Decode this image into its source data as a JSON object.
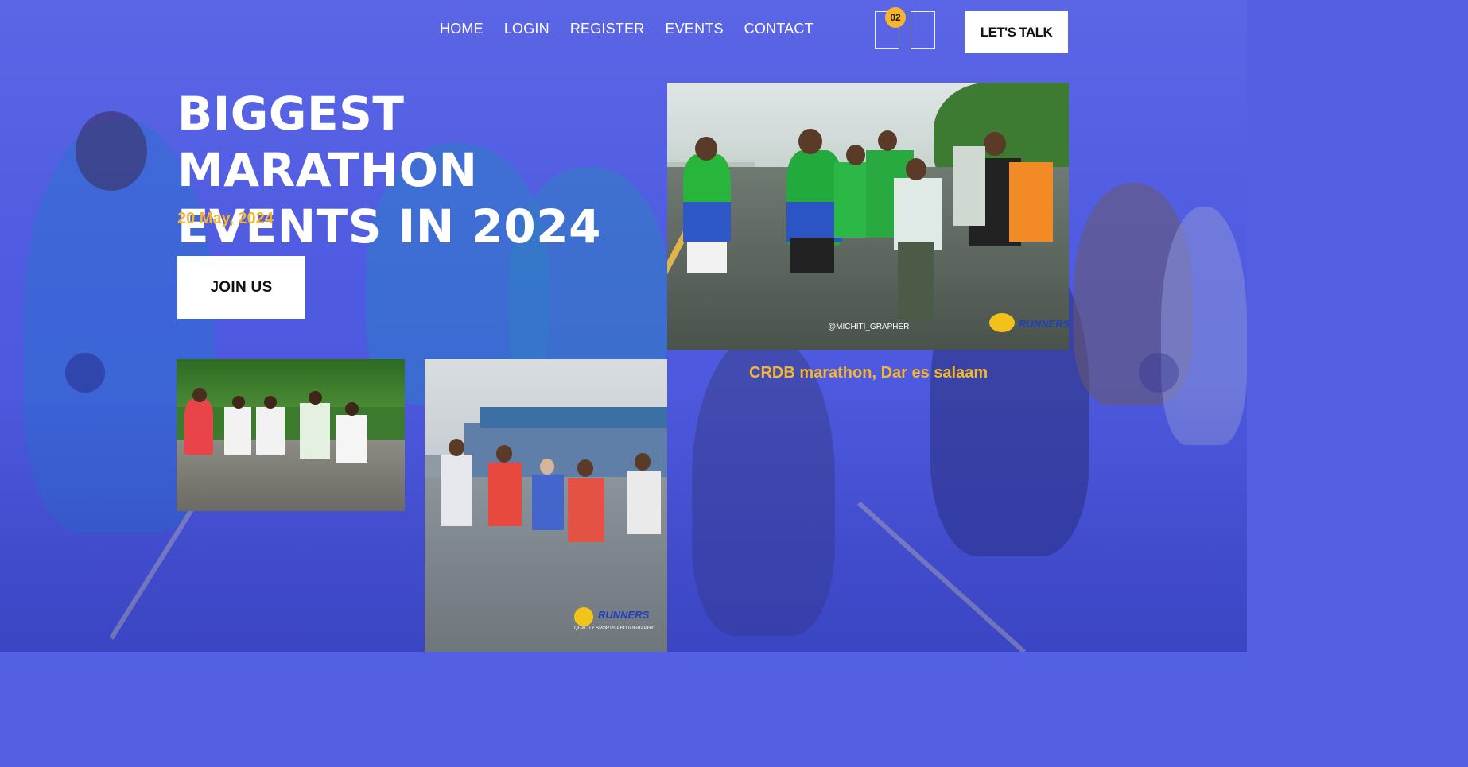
{
  "nav": {
    "items": [
      "HOME",
      "LOGIN",
      "REGISTER",
      "EVENTS",
      "CONTACT"
    ],
    "cart_count": "02",
    "cta_label": "LET'S TALK"
  },
  "hero": {
    "title_line1": "BIGGEST MARATHON",
    "title_line2": "EVENTS IN 2024",
    "date": "20 May, 2024",
    "join_label": "JOIN US"
  },
  "gallery": {
    "main_caption": "CRDB marathon, Dar es salaam",
    "main_watermark": "@MICHITI_GRAPHER",
    "brand_logo": "RUNNERS",
    "small_logo_text": "RUNNERS",
    "small_logo_sub": "QUALITY SPORTS PHOTOGRAPHY"
  },
  "colors": {
    "overlay": "#5360e4",
    "accent": "#f5b530",
    "badge": "#f7b52b",
    "button_bg": "#ffffff"
  },
  "icons": [
    "heart-icon",
    "cart-icon"
  ]
}
